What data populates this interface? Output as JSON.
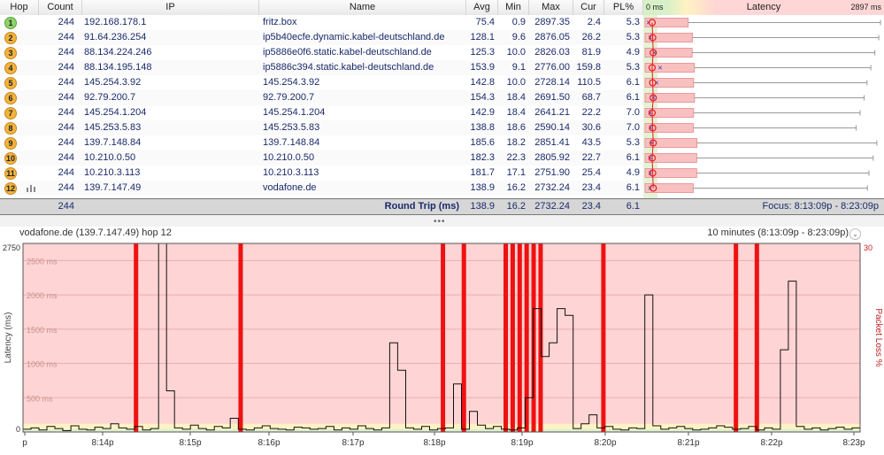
{
  "columns": {
    "hop": "Hop",
    "count": "Count",
    "ip": "IP",
    "name": "Name",
    "avg": "Avg",
    "min": "Min",
    "max": "Max",
    "cur": "Cur",
    "pl": "PL%",
    "latency": "Latency",
    "lat_min": "0 ms",
    "lat_max": "2897 ms"
  },
  "hops": [
    {
      "hop": "1",
      "count": "244",
      "ip": "192.168.178.1",
      "name": "fritz.box",
      "avg": "75.4",
      "min": "0.9",
      "max": "2897.35",
      "cur": "2.4",
      "pl": "5.3",
      "color": "#8fd36b",
      "avg_ms": 75.4,
      "cur_ms": 2.4,
      "max_ms": 2897.35
    },
    {
      "hop": "2",
      "count": "244",
      "ip": "91.64.236.254",
      "name": "ip5b40ecfe.dynamic.kabel-deutschland.de",
      "avg": "128.1",
      "min": "9.6",
      "max": "2876.05",
      "cur": "26.2",
      "pl": "5.3",
      "color": "#f2b43e",
      "avg_ms": 128.1,
      "cur_ms": 26.2,
      "max_ms": 2876.05
    },
    {
      "hop": "3",
      "count": "244",
      "ip": "88.134.224.246",
      "name": "ip5886e0f6.static.kabel-deutschland.de",
      "avg": "125.3",
      "min": "10.0",
      "max": "2826.03",
      "cur": "81.9",
      "pl": "4.9",
      "color": "#f2b43e",
      "avg_ms": 125.3,
      "cur_ms": 81.9,
      "max_ms": 2826.03
    },
    {
      "hop": "4",
      "count": "244",
      "ip": "88.134.195.148",
      "name": "ip5886c394.static.kabel-deutschland.de",
      "avg": "153.9",
      "min": "9.1",
      "max": "2776.00",
      "cur": "159.8",
      "pl": "5.3",
      "color": "#f2b43e",
      "avg_ms": 153.9,
      "cur_ms": 159.8,
      "max_ms": 2776.0
    },
    {
      "hop": "5",
      "count": "244",
      "ip": "145.254.3.92",
      "name": "145.254.3.92",
      "avg": "142.8",
      "min": "10.0",
      "max": "2728.14",
      "cur": "110.5",
      "pl": "6.1",
      "color": "#f2b43e",
      "avg_ms": 142.8,
      "cur_ms": 110.5,
      "max_ms": 2728.14
    },
    {
      "hop": "6",
      "count": "244",
      "ip": "92.79.200.7",
      "name": "92.79.200.7",
      "avg": "154.3",
      "min": "18.4",
      "max": "2691.50",
      "cur": "68.7",
      "pl": "6.1",
      "color": "#f2b43e",
      "avg_ms": 154.3,
      "cur_ms": 68.7,
      "max_ms": 2691.5
    },
    {
      "hop": "7",
      "count": "244",
      "ip": "145.254.1.204",
      "name": "145.254.1.204",
      "avg": "142.9",
      "min": "18.4",
      "max": "2641.21",
      "cur": "22.2",
      "pl": "7.0",
      "color": "#f2b43e",
      "avg_ms": 142.9,
      "cur_ms": 22.2,
      "max_ms": 2641.21
    },
    {
      "hop": "8",
      "count": "244",
      "ip": "145.253.5.83",
      "name": "145.253.5.83",
      "avg": "138.8",
      "min": "18.6",
      "max": "2590.14",
      "cur": "30.6",
      "pl": "7.0",
      "color": "#f2b43e",
      "avg_ms": 138.8,
      "cur_ms": 30.6,
      "max_ms": 2590.14
    },
    {
      "hop": "9",
      "count": "244",
      "ip": "139.7.148.84",
      "name": "139.7.148.84",
      "avg": "185.6",
      "min": "18.2",
      "max": "2851.41",
      "cur": "43.5",
      "pl": "5.3",
      "color": "#f2b43e",
      "avg_ms": 185.6,
      "cur_ms": 43.5,
      "max_ms": 2851.41
    },
    {
      "hop": "10",
      "count": "244",
      "ip": "10.210.0.50",
      "name": "10.210.0.50",
      "avg": "182.3",
      "min": "22.3",
      "max": "2805.92",
      "cur": "22.7",
      "pl": "6.1",
      "color": "#f2b43e",
      "avg_ms": 182.3,
      "cur_ms": 22.7,
      "max_ms": 2805.92
    },
    {
      "hop": "11",
      "count": "244",
      "ip": "10.210.3.113",
      "name": "10.210.3.113",
      "avg": "181.7",
      "min": "17.1",
      "max": "2751.90",
      "cur": "25.4",
      "pl": "4.9",
      "color": "#f2b43e",
      "avg_ms": 181.7,
      "cur_ms": 25.4,
      "max_ms": 2751.9
    },
    {
      "hop": "12",
      "count": "244",
      "ip": "139.7.147.49",
      "name": "vodafone.de",
      "avg": "138.9",
      "min": "16.2",
      "max": "2732.24",
      "cur": "23.4",
      "pl": "6.1",
      "color": "#f2b43e",
      "avg_ms": 138.9,
      "cur_ms": 23.4,
      "max_ms": 2732.24
    }
  ],
  "summary": {
    "count": "244",
    "label": "Round Trip (ms)",
    "avg": "138.9",
    "min": "16.2",
    "max": "2732.24",
    "cur": "23.4",
    "pl": "6.1",
    "focus": "Focus: 8:13:09p - 8:23:09p"
  },
  "chart": {
    "title": "vodafone.de (139.7.147.49) hop 12",
    "range": "10 minutes (8:13:09p - 8:23:09p)",
    "y_left_label": "Latency (ms)",
    "y_right_label": "Packet Loss %",
    "y_top": "2750",
    "y_bottom": "0",
    "y_right_top": "30",
    "grid_labels": [
      "2500 ms",
      "2000 ms",
      "1500 ms",
      "1000 ms",
      "500 ms"
    ],
    "x_labels": [
      "p",
      "8:14p",
      "8:15p",
      "8:16p",
      "8:17p",
      "8:18p",
      "8:19p",
      "8:20p",
      "8:21p",
      "8:22p",
      "8:23p"
    ]
  },
  "chart_data": {
    "type": "line",
    "title": "vodafone.de (139.7.147.49) hop 12",
    "xlabel": "",
    "ylabel": "Latency (ms)",
    "ylim": [
      0,
      2750
    ],
    "x_range": [
      "8:13:09p",
      "8:23:09p"
    ],
    "series": [
      {
        "name": "Latency (ms)",
        "values": [
          40,
          60,
          30,
          80,
          50,
          20,
          90,
          40,
          30,
          70,
          50,
          120,
          60,
          40,
          80,
          30,
          50,
          2750,
          600,
          60,
          40,
          100,
          50,
          30,
          80,
          60,
          200,
          40,
          30,
          60,
          90,
          50,
          40,
          30,
          70,
          60,
          40,
          50,
          80,
          30,
          60,
          40,
          90,
          50,
          30,
          60,
          1300,
          900,
          60,
          40,
          80,
          30,
          50,
          60,
          700,
          40,
          300,
          100,
          50,
          80,
          40,
          30,
          60,
          500,
          1800,
          1100,
          1300,
          1800,
          1700,
          50,
          120,
          250,
          60,
          80,
          40,
          30,
          60,
          50,
          2000,
          90,
          40,
          60,
          80,
          50,
          30,
          40,
          60,
          90,
          70,
          40,
          50,
          80,
          30,
          60,
          40,
          1200,
          2200,
          80,
          40,
          60,
          30,
          50,
          70,
          40,
          60
        ]
      }
    ],
    "packet_loss_events": [
      "8:14:30p",
      "8:15:45p",
      "8:18:10p",
      "8:18:25p",
      "8:18:55p",
      "8:19:00p",
      "8:19:05p",
      "8:19:10p",
      "8:19:15p",
      "8:19:20p",
      "8:20:05p",
      "8:21:40p",
      "8:21:55p"
    ],
    "y2_label": "Packet Loss %",
    "y2lim": [
      0,
      30
    ]
  }
}
